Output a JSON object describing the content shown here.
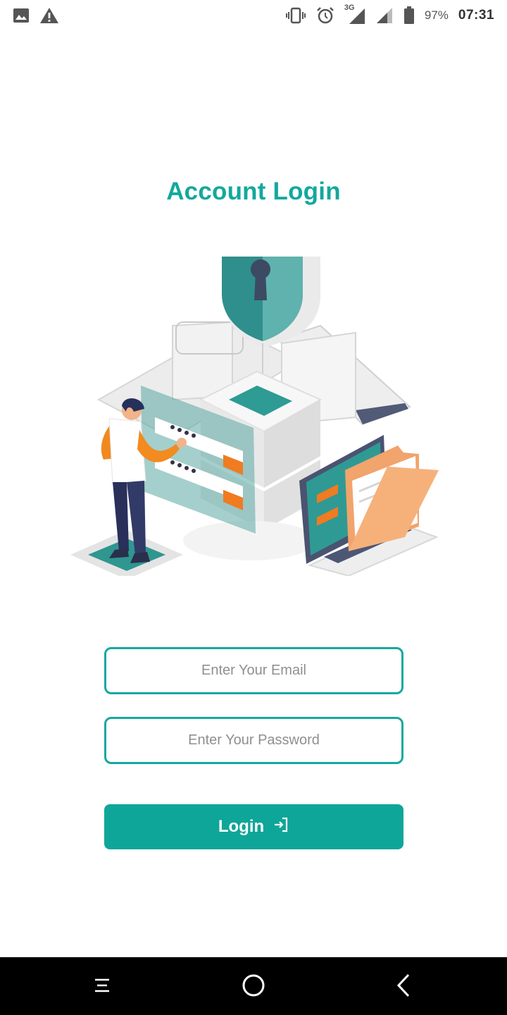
{
  "status_bar": {
    "battery_percent": "97%",
    "time": "07:31",
    "network_label": "3G",
    "icons": [
      "image-icon",
      "warning-icon",
      "vibrate-icon",
      "alarm-icon",
      "signal-3g-icon",
      "signal-icon",
      "battery-icon"
    ]
  },
  "page": {
    "title": "Account Login"
  },
  "form": {
    "email_placeholder": "Enter Your Email",
    "password_placeholder": "Enter Your Password",
    "login_label": "Login",
    "login_icon": "login-arrow-icon"
  },
  "colors": {
    "accent": "#13a89e",
    "button": "#0ea699",
    "field_border": "#16a89f",
    "nav_bar": "#000000"
  },
  "nav_bar": {
    "icons": [
      "menu-icon",
      "home-icon",
      "back-icon"
    ]
  }
}
